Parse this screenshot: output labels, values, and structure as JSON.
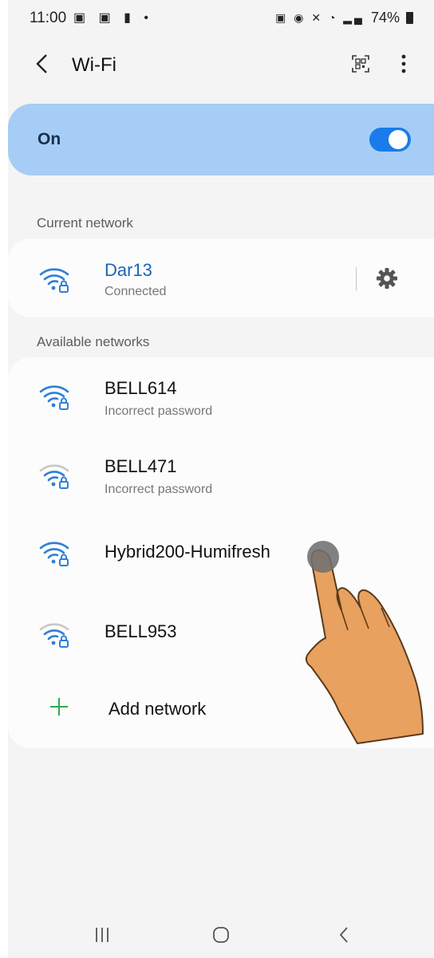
{
  "status_bar": {
    "time": "11:00",
    "left_icons": "▣ ▣ ▮ •",
    "right_icons": "▣ ◉ ✕ ◔ ▂▄",
    "battery": "74%"
  },
  "header": {
    "title": "Wi-Fi",
    "back_icon": "back-arrow-icon",
    "qr_icon": "qr-code-icon",
    "more_icon": "more-options-icon"
  },
  "wifi_toggle": {
    "label": "On",
    "state": "on",
    "accent": "#1a7bea",
    "card_color": "#a6cdf5"
  },
  "current_network": {
    "section_label": "Current network",
    "name": "Dar13",
    "status": "Connected",
    "name_color": "#1a66b8",
    "settings_icon": "gear-icon"
  },
  "available_networks": {
    "section_label": "Available networks",
    "items": [
      {
        "name": "BELL614",
        "status": "Incorrect password",
        "signal": "strong"
      },
      {
        "name": "BELL471",
        "status": "Incorrect password",
        "signal": "weak"
      },
      {
        "name": "Hybrid200-Humifresh",
        "status": "",
        "signal": "strong"
      },
      {
        "name": "BELL953",
        "status": "",
        "signal": "weak"
      }
    ],
    "add_label": "Add network",
    "add_icon": "plus-icon"
  },
  "nav_bar": {
    "recent_icon": "recent-apps-icon",
    "home_icon": "home-icon",
    "back_icon": "back-icon"
  }
}
